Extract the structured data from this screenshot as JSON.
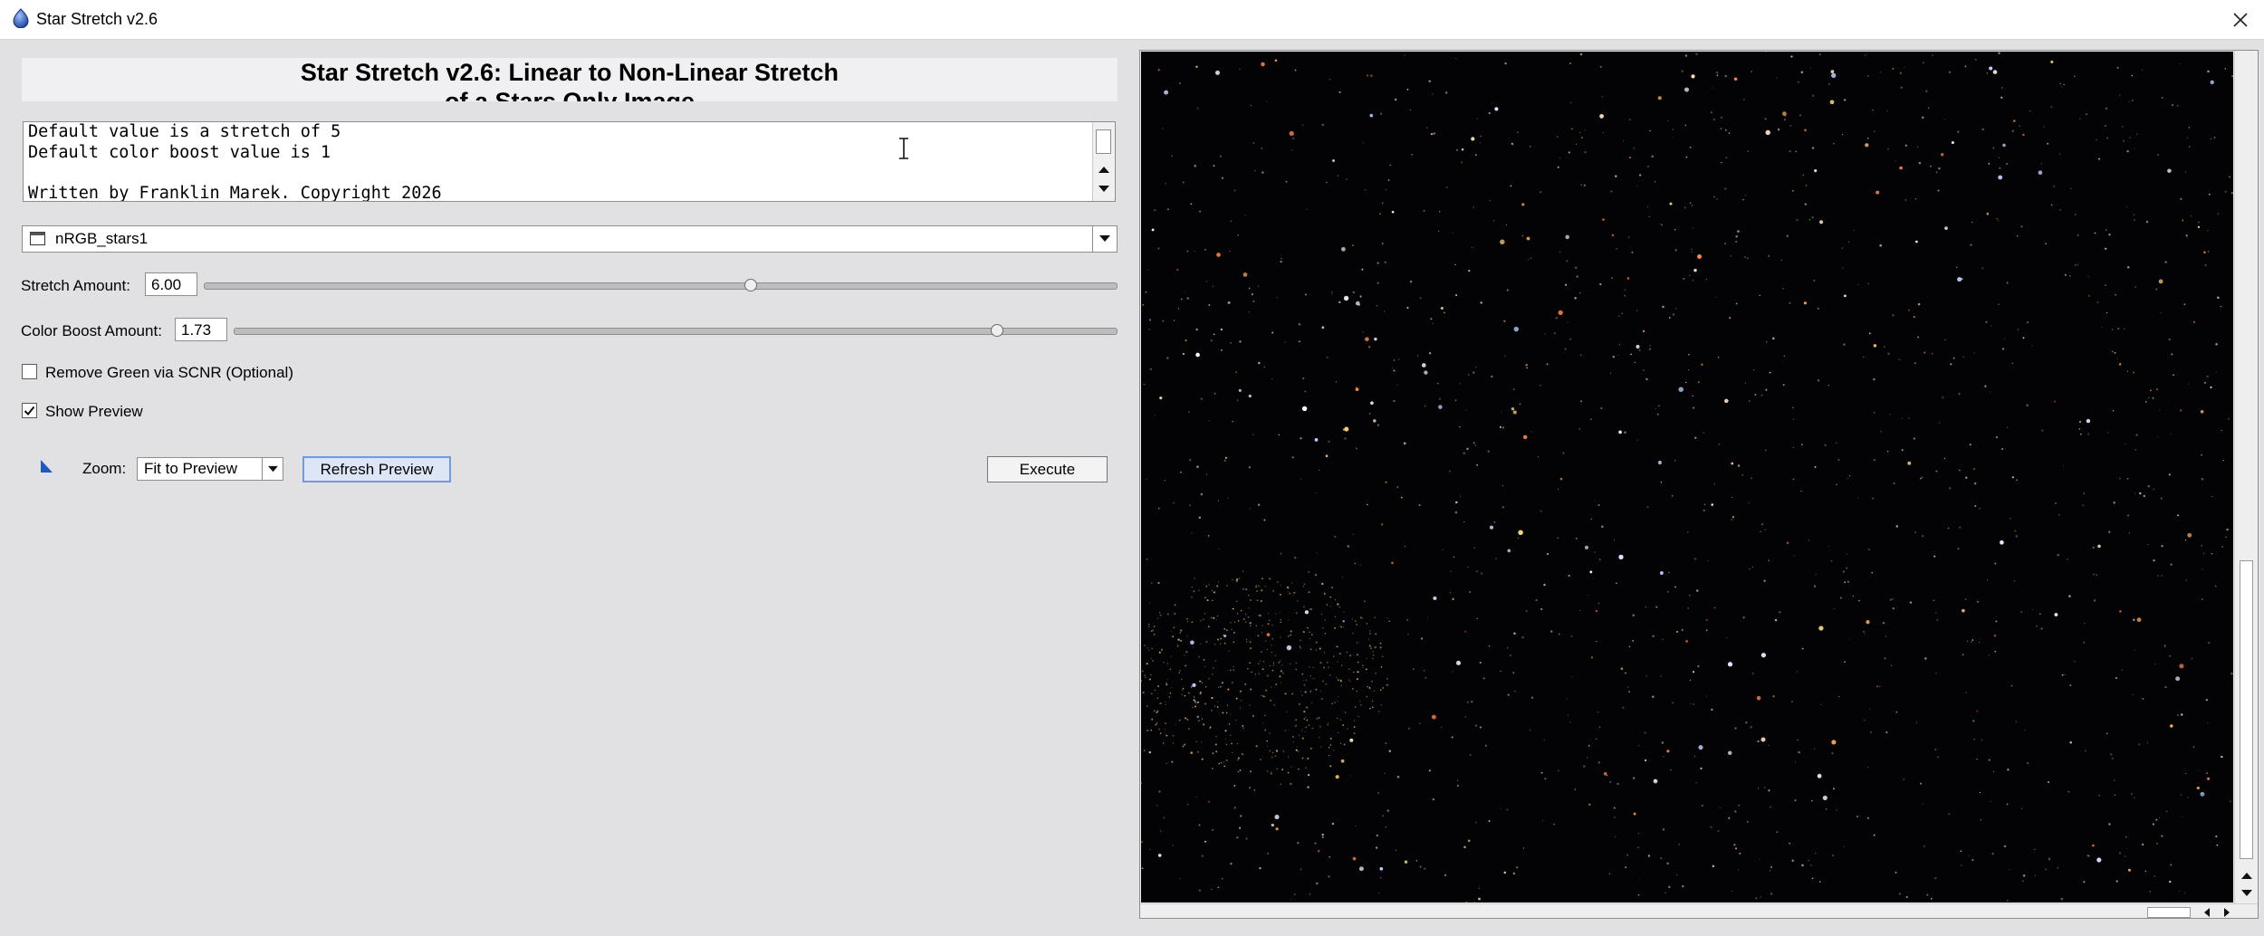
{
  "window": {
    "title": "Star Stretch v2.6"
  },
  "header": {
    "line1": "Star Stretch v2.6: Linear to Non-Linear Stretch",
    "line2": "of a Stars Only Image"
  },
  "info": {
    "text": "Default value is a stretch of 5\nDefault color boost value is 1\n\nWritten by Franklin Marek. Copyright 2026"
  },
  "image_selector": {
    "value": "nRGB_stars1"
  },
  "stretch": {
    "label": "Stretch Amount:",
    "value": "6.00",
    "fraction": 0.6
  },
  "color_boost": {
    "label": "Color Boost Amount:",
    "value": "1.73",
    "fraction": 0.865
  },
  "scnr": {
    "label": "Remove Green via SCNR (Optional)",
    "checked": false
  },
  "show_preview": {
    "label": "Show Preview",
    "checked": true
  },
  "zoom": {
    "label": "Zoom:",
    "value": "Fit to Preview"
  },
  "buttons": {
    "refresh": "Refresh Preview",
    "execute": "Execute"
  },
  "icons": {
    "app": "app-logo-icon",
    "close": "close-icon",
    "image_selector": "window-icon",
    "dropdown": "chevron-down-icon",
    "zoom": "resize-corner-icon",
    "checkmark": "checkmark-icon",
    "cursor": "text-cursor-icon"
  },
  "colors": {
    "accent": "#6e9ae0",
    "app_background": "#e1e1e4",
    "preview_background": "#030204"
  }
}
